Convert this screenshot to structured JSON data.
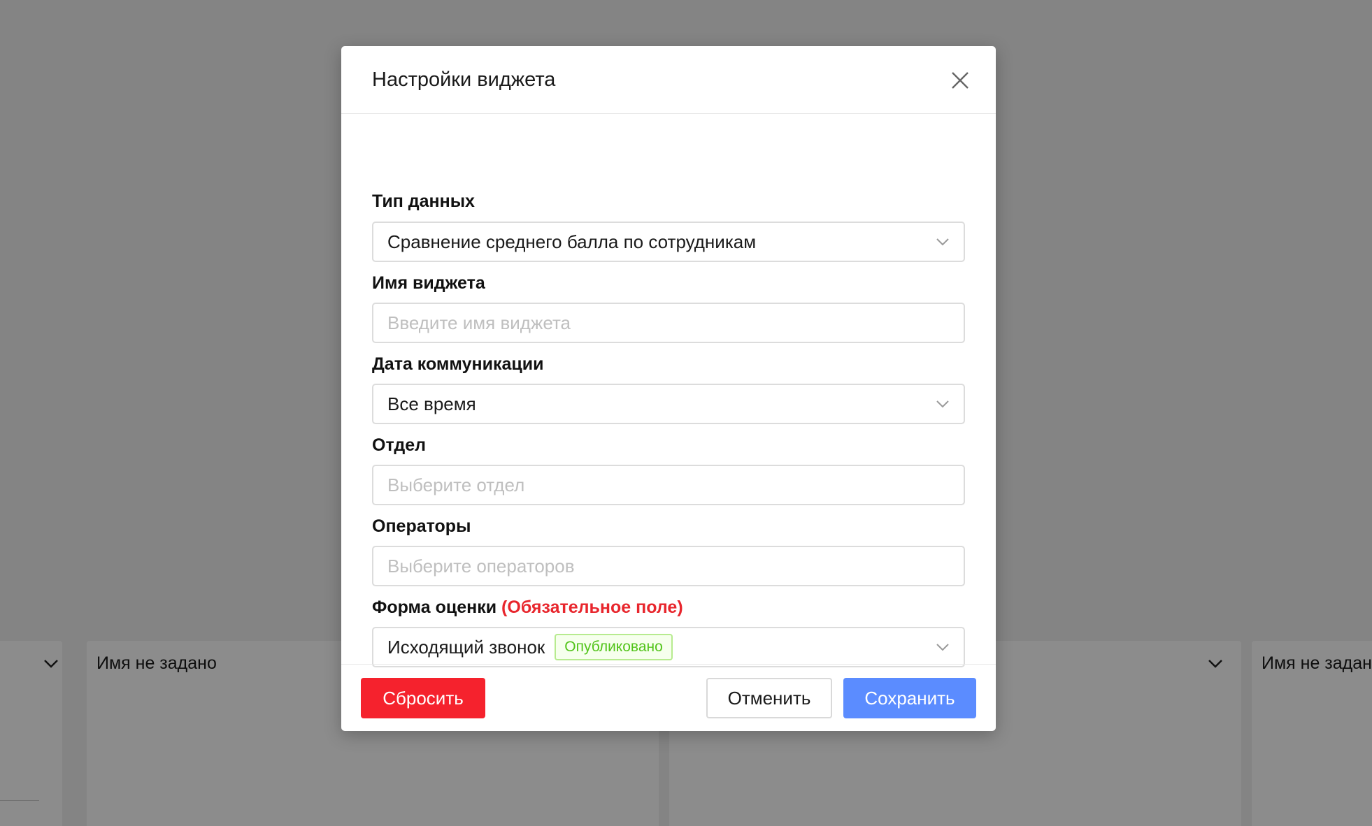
{
  "background": {
    "cards": [
      {
        "title": ""
      },
      {
        "title": "Имя не задано"
      },
      {
        "title": ""
      },
      {
        "title": "Имя не задано"
      }
    ]
  },
  "modal": {
    "title": "Настройки виджета",
    "fields": {
      "data_type": {
        "label": "Тип данных",
        "value": "Сравнение среднего балла по сотрудникам"
      },
      "widget_name": {
        "label": "Имя виджета",
        "placeholder": "Введите имя виджета"
      },
      "comm_date": {
        "label": "Дата коммуникации",
        "value": "Все время"
      },
      "department": {
        "label": "Отдел",
        "placeholder": "Выберите отдел"
      },
      "operators": {
        "label": "Операторы",
        "placeholder": "Выберите операторов"
      },
      "eval_form": {
        "label": "Форма оценки",
        "required_note": "(Обязательное поле)",
        "value": "Исходящий звонок",
        "badge": "Опубликовано"
      }
    },
    "footer": {
      "reset_label": "Сбросить",
      "cancel_label": "Отменить",
      "save_label": "Сохранить"
    }
  },
  "colors": {
    "overlay": "#000000",
    "danger": "#f5222d",
    "primary": "#5b8cff",
    "success": "#52c41a",
    "required": "#e8262d"
  },
  "icons": {
    "close": "close-icon",
    "dropdown": "chevron-down-icon"
  }
}
